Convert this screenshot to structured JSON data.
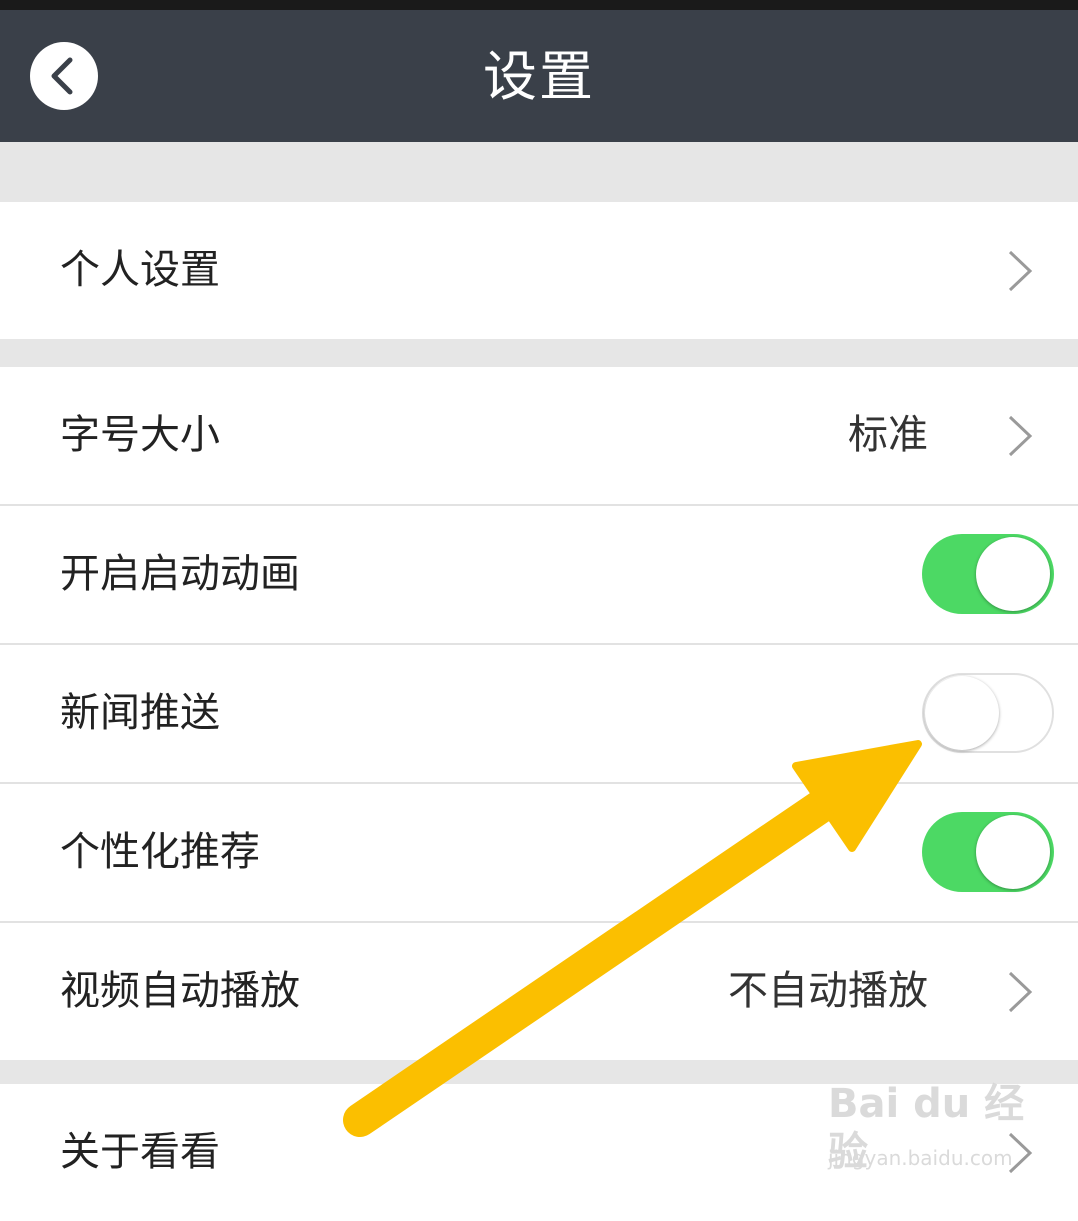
{
  "header": {
    "title": "设置",
    "back_icon": "chevron-left-icon"
  },
  "groups": [
    {
      "rows": [
        {
          "label": "个人设置",
          "type": "link"
        }
      ]
    },
    {
      "rows": [
        {
          "label": "字号大小",
          "type": "link",
          "value": "标准"
        },
        {
          "label": "开启启动动画",
          "type": "toggle",
          "state": "on"
        },
        {
          "label": "新闻推送",
          "type": "toggle",
          "state": "off"
        },
        {
          "label": "个性化推荐",
          "type": "toggle",
          "state": "on"
        },
        {
          "label": "视频自动播放",
          "type": "link",
          "value": "不自动播放"
        }
      ]
    },
    {
      "rows": [
        {
          "label": "关于看看",
          "type": "link"
        }
      ]
    }
  ],
  "colors": {
    "header_bg": "#3a4049",
    "toggle_on": "#4cd964",
    "arrow": "#fbbf00",
    "page_bg": "#e6e6e6"
  },
  "watermark": {
    "logo": "Bai du 经验",
    "url": "jingyan.baidu.com"
  }
}
